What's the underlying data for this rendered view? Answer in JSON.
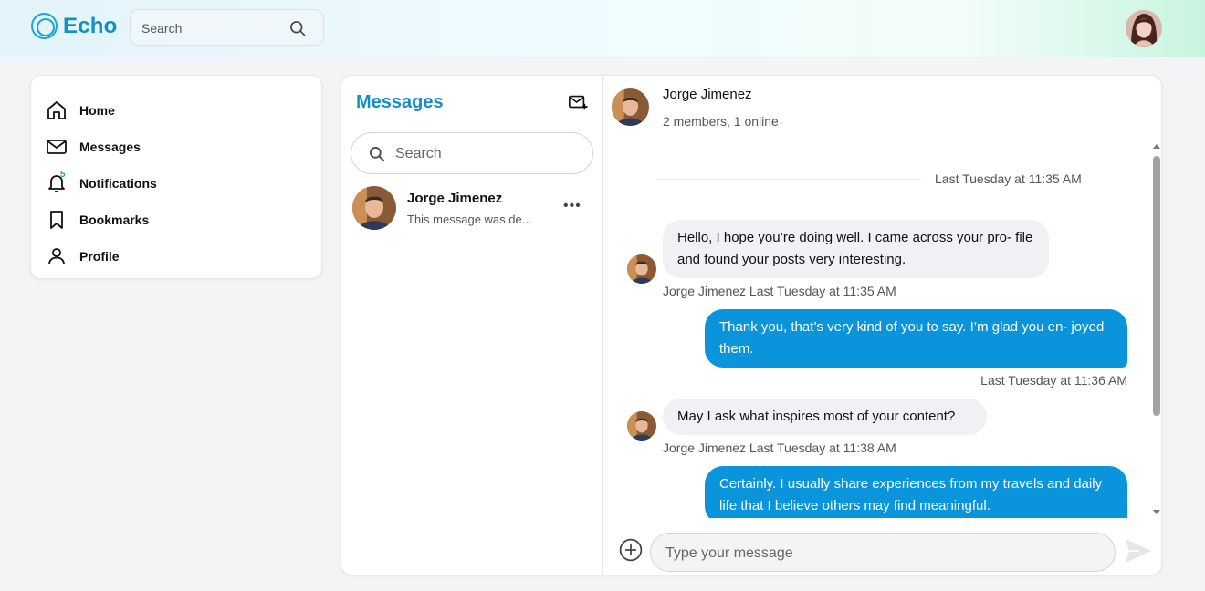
{
  "header": {
    "brand": "Echo",
    "search_placeholder": "Search"
  },
  "sidebar": {
    "items": [
      {
        "label": "Home",
        "icon": "home-icon"
      },
      {
        "label": "Messages",
        "icon": "mail-icon"
      },
      {
        "label": "Notifications",
        "icon": "bell-icon",
        "badge": "5"
      },
      {
        "label": "Bookmarks",
        "icon": "bookmark-icon"
      },
      {
        "label": "Profile",
        "icon": "user-icon"
      }
    ]
  },
  "conversations": {
    "title": "Messages",
    "search_placeholder": "Search",
    "items": [
      {
        "name": "Jorge Jimenez",
        "preview": "This message was de..."
      }
    ]
  },
  "chat": {
    "name": "Jorge Jimenez",
    "meta": "2 members, 1 online",
    "divider": "Last Tuesday at 11:35 AM",
    "messages": [
      {
        "direction": "in",
        "text": "Hello, I hope you’re doing well. I came across your pro- file and found your posts very interesting.",
        "stamp": "Jorge Jimenez Last Tuesday at 11:35 AM"
      },
      {
        "direction": "out",
        "text": "Thank you, that’s very kind of you to say. I’m glad you en- joyed them.",
        "stamp": "Last Tuesday at 11:36 AM"
      },
      {
        "direction": "in",
        "text": "May I ask what inspires most of your content?",
        "stamp": "Jorge Jimenez Last Tuesday at 11:38 AM"
      },
      {
        "direction": "out",
        "text": "Certainly. I usually share experiences from my travels and daily life that I believe others may find meaningful.",
        "stamp": ""
      }
    ],
    "composer_placeholder": "Type your message"
  },
  "colors": {
    "accent": "#128fc8",
    "outgoing_bubble": "#0a94dc",
    "incoming_bubble": "#eff1f4"
  }
}
